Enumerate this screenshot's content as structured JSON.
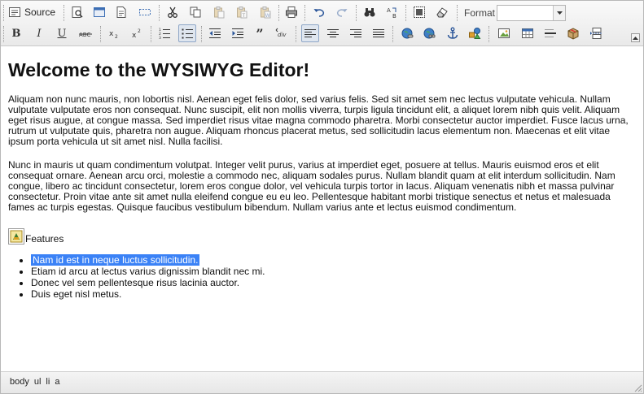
{
  "toolbar": {
    "source_label": "Source",
    "format_label": "Format",
    "format_value": ""
  },
  "content": {
    "heading": "Welcome to the WYSIWYG Editor!",
    "paragraph1": "Aliquam non nunc mauris, non lobortis nisl. Aenean eget felis dolor, sed varius felis. Sed sit amet sem nec lectus vulputate vehicula. Nullam vulputate vulputate eros non consequat. Nunc suscipit, elit non mollis viverra, turpis ligula tincidunt elit, a aliquet lorem nibh quis velit. Aliquam eget risus augue, at congue massa. Sed imperdiet risus vitae magna commodo pharetra. Morbi consectetur auctor imperdiet. Fusce lacus urna, rutrum ut vulputate quis, pharetra non augue. Aliquam rhoncus placerat metus, sed sollicitudin lacus elementum non. Maecenas et elit vitae ipsum porta vehicula ut sit amet nisl. Nulla facilisi.",
    "paragraph2": "Nunc in mauris ut quam condimentum volutpat. Integer velit purus, varius at imperdiet eget, posuere at tellus. Mauris euismod eros et elit consequat ornare. Aenean arcu orci, molestie a commodo nec, aliquam sodales purus. Nullam blandit quam at elit interdum sollicitudin. Nam congue, libero ac tincidunt consectetur, lorem eros congue dolor, vel vehicula turpis tortor in lacus. Aliquam venenatis nibh et massa pulvinar consectetur. Proin vitae ante sit amet nulla eleifend congue eu eu leo. Pellentesque habitant morbi tristique senectus et netus et malesuada fames ac turpis egestas. Quisque faucibus vestibulum bibendum. Nullam varius ante et lectus euismod condimentum.",
    "features_label": "Features",
    "list_items": [
      "Nam id est in neque luctus sollicitudin.",
      "Etiam id arcu at lectus varius dignissim blandit nec mi.",
      "Donec vel sem pellentesque risus lacinia auctor.",
      "Duis eget nisl metus."
    ]
  },
  "statusbar": {
    "path": [
      "body",
      "ul",
      "li",
      "a"
    ]
  },
  "colors": {
    "selection": "#3b82f6",
    "active_button_bg": "#dfe6ef",
    "toolbar_border": "#c9c9c9"
  }
}
